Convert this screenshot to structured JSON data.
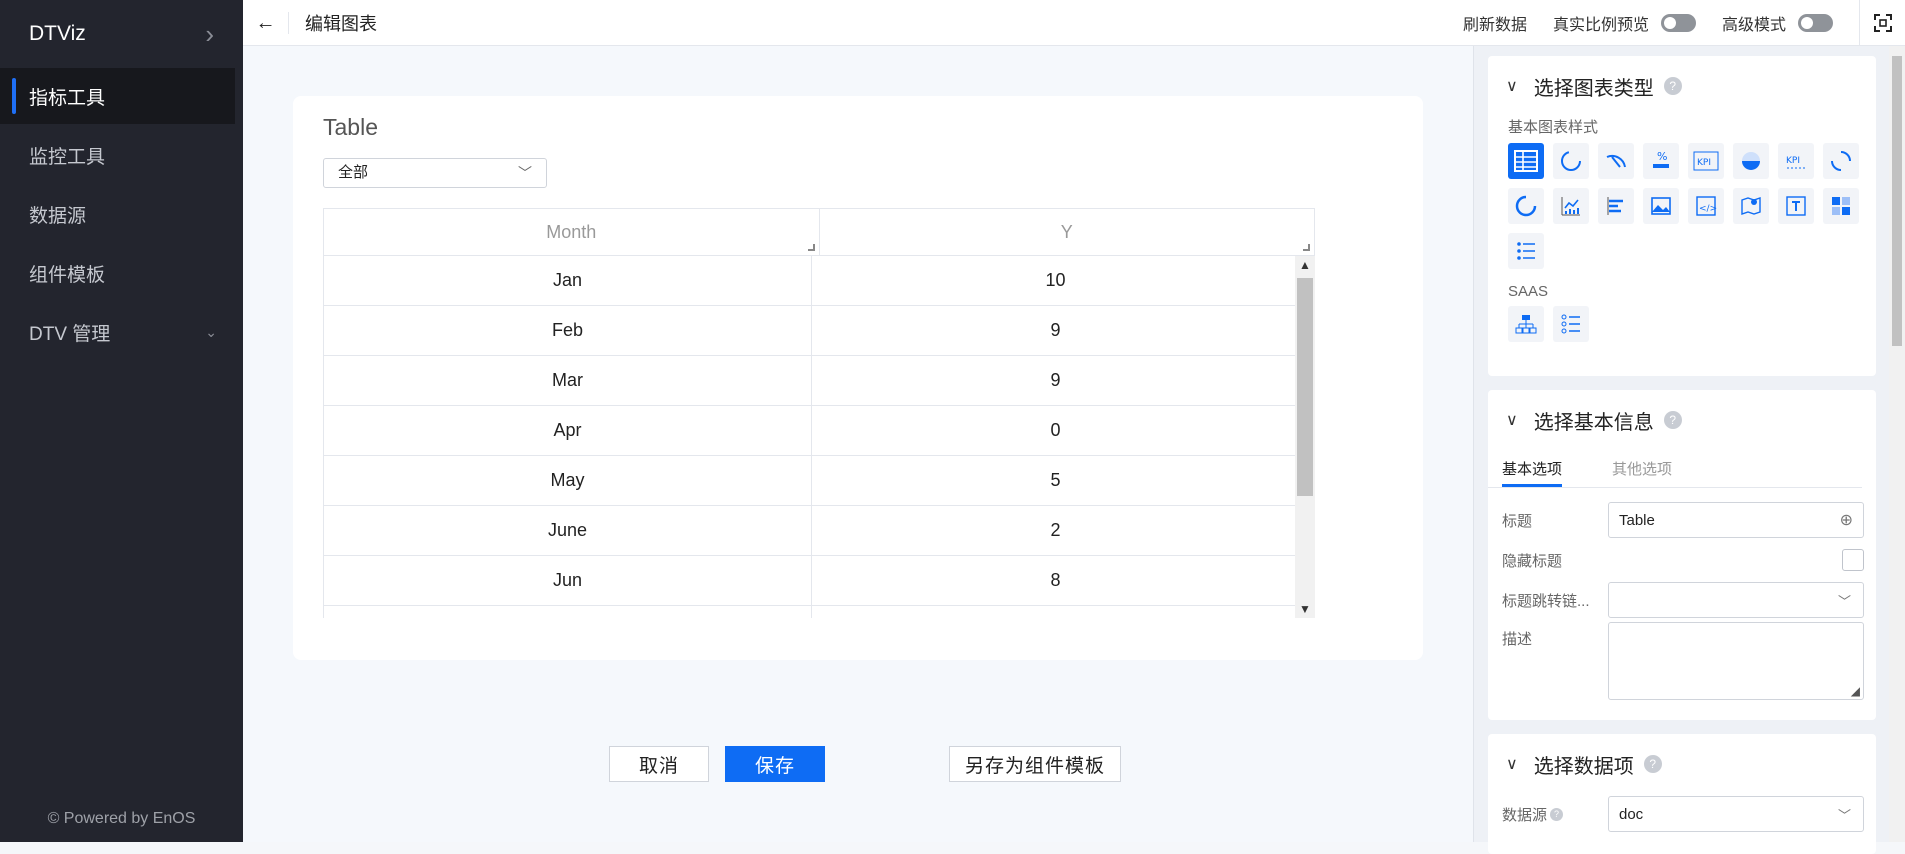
{
  "sidebar": {
    "brand": "DTViz",
    "items": [
      {
        "label": "指标工具"
      },
      {
        "label": "监控工具"
      },
      {
        "label": "数据源"
      },
      {
        "label": "组件模板"
      },
      {
        "label": "DTV 管理"
      }
    ],
    "powered": "© Powered by EnOS"
  },
  "header": {
    "title": "编辑图表",
    "refresh": "刷新数据",
    "real_preview": "真实比例预览",
    "advanced_mode": "高级模式"
  },
  "card": {
    "title": "Table",
    "filter_value": "全部",
    "columns": [
      "Month",
      "Y"
    ],
    "rows": [
      [
        "Jan",
        "10"
      ],
      [
        "Feb",
        "9"
      ],
      [
        "Mar",
        "9"
      ],
      [
        "Apr",
        "0"
      ],
      [
        "May",
        "5"
      ],
      [
        "June",
        "2"
      ],
      [
        "Jun",
        "8"
      ],
      [
        "",
        ""
      ]
    ]
  },
  "actions": {
    "cancel": "取消",
    "save": "保存",
    "save_template": "另存为组件模板"
  },
  "panel": {
    "chart_type": {
      "heading": "选择图表类型",
      "basic_label": "基本图表样式",
      "saas_label": "SAAS",
      "icons": [
        "table-icon",
        "ring-icon",
        "gauge-icon",
        "percent-icon",
        "kpi-icon",
        "half-pie-icon",
        "kpi-dots-icon",
        "donut-quarter-icon",
        "arc-icon",
        "line-bar-icon",
        "bar-horizontal-icon",
        "image-icon",
        "code-icon",
        "map-pin-icon",
        "text-icon",
        "heatmap-icon",
        "list-icon"
      ],
      "saas_icons": [
        "org-chart-icon",
        "bullet-list-icon"
      ]
    },
    "basic_info": {
      "heading": "选择基本信息",
      "tabs": [
        "基本选项",
        "其他选项"
      ],
      "title_label": "标题",
      "title_value": "Table",
      "hide_title_label": "隐藏标题",
      "title_link_label": "标题跳转链...",
      "desc_label": "描述"
    },
    "data_items": {
      "heading": "选择数据项",
      "source_label": "数据源",
      "source_value": "doc"
    }
  },
  "colors": {
    "accent": "#0e6cf4",
    "sidebar_bg": "#23252e"
  }
}
